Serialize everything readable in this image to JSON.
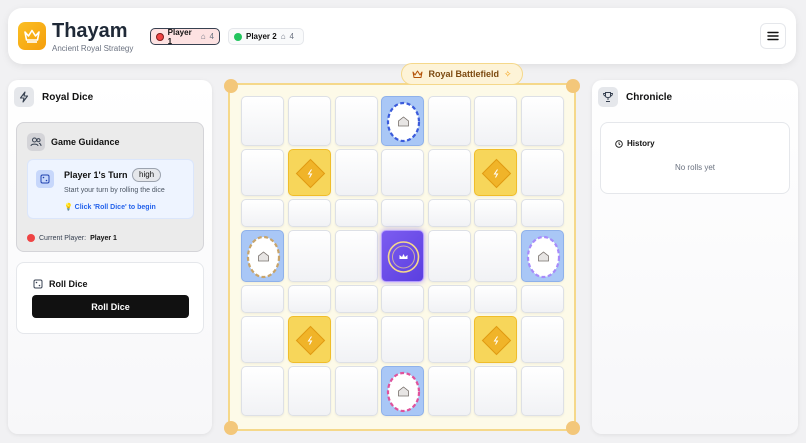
{
  "header": {
    "title": "Thayam",
    "subtitle": "Ancient Royal Strategy",
    "players": [
      {
        "name": "Player 1",
        "count": "4",
        "color": "#ef4444",
        "active": true
      },
      {
        "name": "Player 2",
        "count": "4",
        "color": "#22c55e",
        "active": false
      }
    ],
    "menu_icon": "menu-icon"
  },
  "left_panel": {
    "title": "Royal Dice",
    "guidance": {
      "title": "Game Guidance",
      "turn_title": "Player 1's Turn",
      "priority": "high",
      "description": "Start your turn by rolling the dice",
      "cta": "Click 'Roll Dice' to begin",
      "current_label": "Current Player:",
      "current_player": "Player 1"
    },
    "roll": {
      "title": "Roll Dice",
      "button_label": "Roll Dice"
    }
  },
  "board": {
    "title": "Royal Battlefield",
    "size": 7,
    "home_color": "#a9c7f6",
    "bonus_color": "#f7d65a",
    "center_color": "#7c5cf0",
    "homes": [
      {
        "row": 0,
        "col": 3,
        "ring_color": "#3b5bdb"
      },
      {
        "row": 3,
        "col": 0,
        "ring_color": "#c8a46a"
      },
      {
        "row": 3,
        "col": 6,
        "ring_color": "#a78bfa"
      },
      {
        "row": 6,
        "col": 3,
        "ring_color": "#e0529c"
      }
    ],
    "bonus": [
      {
        "row": 1,
        "col": 1
      },
      {
        "row": 1,
        "col": 5
      },
      {
        "row": 5,
        "col": 1
      },
      {
        "row": 5,
        "col": 5
      }
    ],
    "center": {
      "row": 3,
      "col": 3
    }
  },
  "right_panel": {
    "title": "Chronicle",
    "history_title": "History",
    "empty_text": "No rolls yet"
  }
}
